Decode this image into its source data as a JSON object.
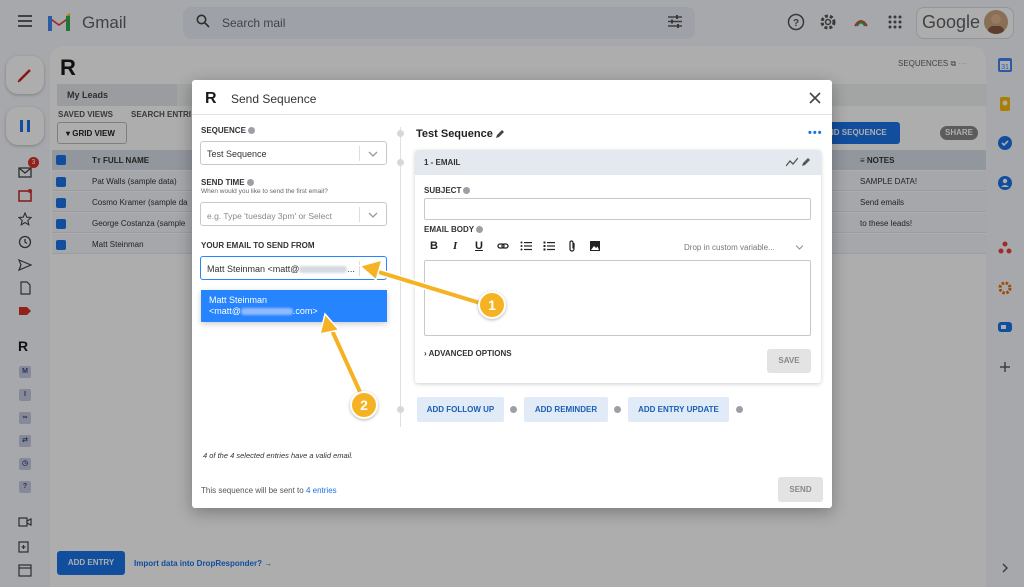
{
  "gmail": {
    "wordmark": "Gmail",
    "search_placeholder": "Search mail",
    "google_label": "Google",
    "inbox_badge": "3"
  },
  "dropresponder": {
    "logo": "R",
    "sequences_link": "SEQUENCES",
    "tab_my_leads": "My Leads",
    "saved_views_label": "SAVED VIEWS",
    "search_entries_label": "SEARCH ENTRI",
    "grid_view_label": "GRID VIEW",
    "send_sequence_label": "ND SEQUENCE",
    "share_label": "SHARE",
    "col_full_name": "FULL NAME",
    "col_notes": "NOTES",
    "rows": [
      {
        "name": "Pat Walls (sample data)",
        "note": "SAMPLE DATA!"
      },
      {
        "name": "Cosmo Kramer (sample da",
        "note": "Send emails"
      },
      {
        "name": "George Costanza (sample",
        "note": "to these leads!"
      },
      {
        "name": "Matt Steinman",
        "note": ""
      }
    ],
    "add_entry_label": "ADD ENTRY",
    "import_label": "Import data into DropResponder? →"
  },
  "modal": {
    "logo": "R",
    "title": "Send Sequence",
    "sequence_label": "SEQUENCE",
    "sequence_value": "Test Sequence",
    "send_time_label": "SEND TIME",
    "send_time_sub": "When would you like to send the first email?",
    "send_time_placeholder": "e.g. Type 'tuesday 3pm' or Select",
    "email_from_label": "YOUR EMAIL TO SEND FROM",
    "email_from_value_prefix": "Matt Steinman <matt@",
    "email_from_value_suffix": "...",
    "dropdown_option_name": "Matt Steinman",
    "dropdown_option_prefix": "<matt@",
    "dropdown_option_suffix": ".com>",
    "valid_note": "4 of the 4 selected entries have a valid email.",
    "sent_note_prefix": "This sequence will be sent to ",
    "sent_note_link": "4 entries",
    "send_label": "SEND"
  },
  "sequence_panel": {
    "name": "Test Sequence",
    "step_label": "1 - EMAIL",
    "subject_label": "SUBJECT",
    "body_label": "EMAIL BODY",
    "variable_placeholder": "Drop in custom variable...",
    "advanced_label": "ADVANCED OPTIONS",
    "save_label": "SAVE",
    "add_follow_up": "ADD FOLLOW UP",
    "add_reminder": "ADD REMINDER",
    "add_entry_update": "ADD ENTRY UPDATE"
  },
  "annotations": [
    "1",
    "2"
  ],
  "colors": {
    "accent_blue": "#1a73e8",
    "dropdown_blue": "#2684ff",
    "annotation_yellow": "#f5b324"
  }
}
